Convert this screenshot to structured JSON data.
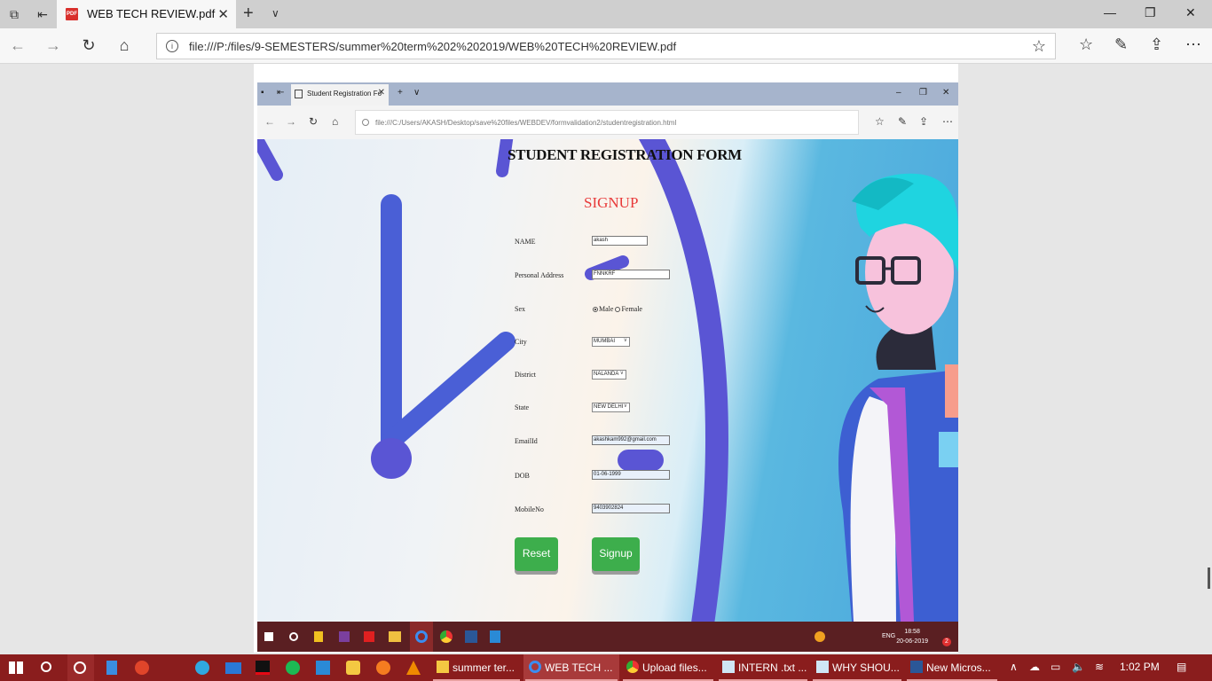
{
  "browser": {
    "tab_title": "WEB TECH REVIEW.pdf",
    "pdf_badge": "PDF",
    "url": "file:///P:/files/9-SEMESTERS/summer%20term%202%202019/WEB%20TECH%20REVIEW.pdf"
  },
  "inner_browser": {
    "tab_title": "Student Registration Fo",
    "url": "file:///C:/Users/AKASH/Desktop/save%20files/WEBDEV/formvalidation2/studentregistration.html"
  },
  "form": {
    "title": "STUDENT REGISTRATION FORM",
    "heading": "SIGNUP",
    "labels": {
      "name": "NAME",
      "address": "Personal Address",
      "sex": "Sex",
      "city": "City",
      "district": "District",
      "state": "State",
      "email": "EmailId",
      "dob": "DOB",
      "mobile": "MobileNo"
    },
    "values": {
      "name": "akash",
      "address": "FNNKRF",
      "sex_male": "Male",
      "sex_female": "Female",
      "city": "MUMBAI",
      "district": "NALANDA",
      "state": "NEW DELHI",
      "email": "akashkam992@gmail.com",
      "dob": "01-06-1999",
      "mobile": "9403902824"
    },
    "buttons": {
      "reset": "Reset",
      "signup": "Signup"
    }
  },
  "inner_taskbar": {
    "lang": "ENG",
    "time": "18:58",
    "date": "20-06-2019",
    "notif": "2"
  },
  "taskbar": {
    "apps": [
      {
        "label": "summer ter...",
        "color": "#f4c842"
      },
      {
        "label": "WEB TECH ...",
        "color": "#1a73e8"
      },
      {
        "label": "Upload files...",
        "color": "#e8b830"
      },
      {
        "label": "INTERN .txt ...",
        "color": "#cfe6f5"
      },
      {
        "label": "WHY SHOU...",
        "color": "#cfe6f5"
      },
      {
        "label": "New Micros...",
        "color": "#2b5797"
      }
    ],
    "time": "1:02 PM"
  },
  "colors": {
    "taskbar": "#8a1d1d",
    "signup_heading": "#e83a3a",
    "button_green": "#3dae4c",
    "clock_hand": "#4a5fd6"
  }
}
